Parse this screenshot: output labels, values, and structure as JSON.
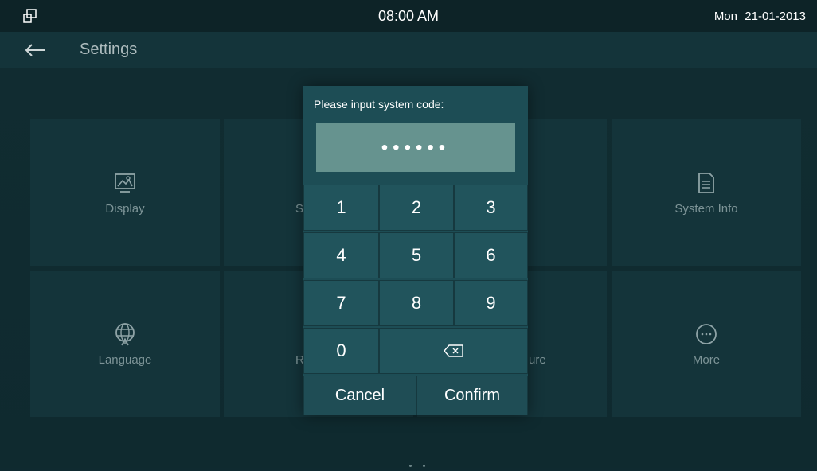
{
  "statusbar": {
    "time": "08:00 AM",
    "day": "Mon",
    "date": "21-01-2013"
  },
  "header": {
    "title": "Settings"
  },
  "tiles": [
    {
      "label": "Display",
      "icon": "display-icon"
    },
    {
      "label": "S",
      "icon": ""
    },
    {
      "label": "",
      "icon": ""
    },
    {
      "label": "System Info",
      "icon": "document-icon"
    },
    {
      "label": "Language",
      "icon": "globe-icon"
    },
    {
      "label": "R",
      "icon": ""
    },
    {
      "label": "ure",
      "icon": ""
    },
    {
      "label": "More",
      "icon": "more-icon"
    }
  ],
  "dialog": {
    "prompt": "Please input system code:",
    "code_mask": "••••••",
    "keys": [
      "1",
      "2",
      "3",
      "4",
      "5",
      "6",
      "7",
      "8",
      "9",
      "0"
    ],
    "cancel": "Cancel",
    "confirm": "Confirm"
  }
}
